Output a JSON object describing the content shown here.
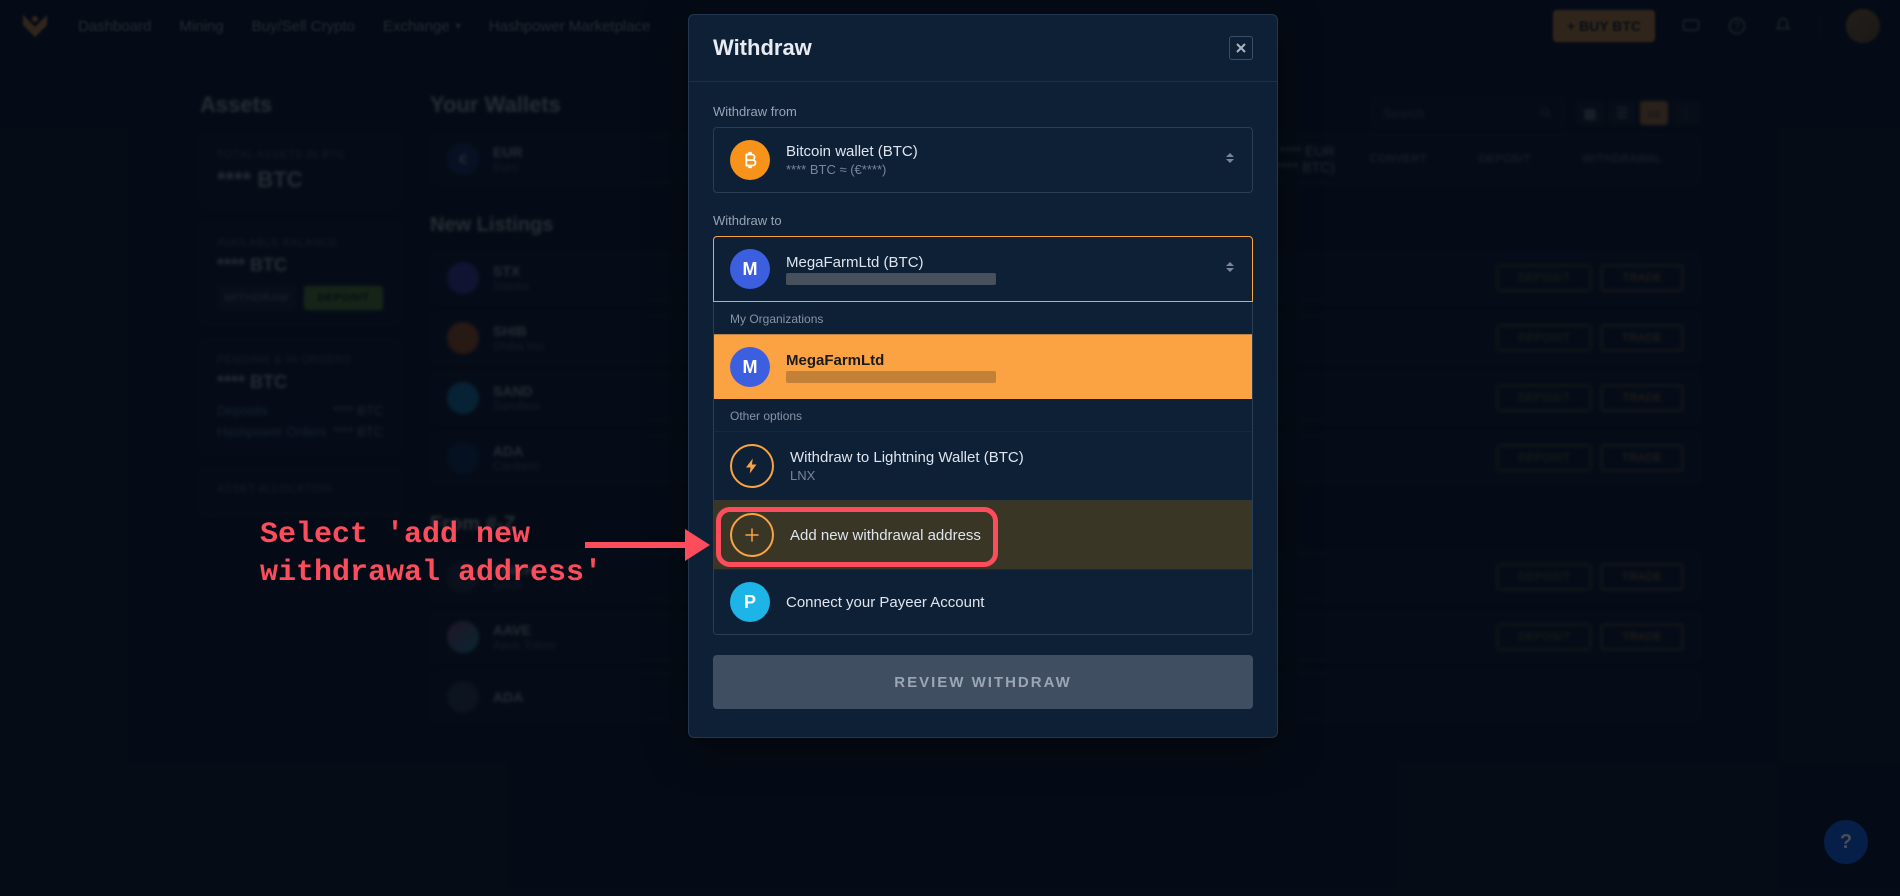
{
  "nav": {
    "items": [
      "Dashboard",
      "Mining",
      "Buy/Sell Crypto",
      "Exchange",
      "Hashpower Marketplace"
    ],
    "buy_label": "+ BUY BTC"
  },
  "assets": {
    "heading": "Assets",
    "total_label": "TOTAL ASSETS IN BTC",
    "total_value": "**** BTC",
    "avail_label": "AVAILABLE BALANCE",
    "avail_value": "**** BTC",
    "withdraw": "WITHDRAW",
    "deposit": "DEPOSIT",
    "pending_label": "PENDING & IN ORDERS",
    "pending_value": "**** BTC",
    "deposits_label": "Deposits",
    "deposits_value": "**** BTC",
    "hash_label": "Hashpower Orders",
    "hash_value": "**** BTC",
    "allocation_label": "ASSET ALLOCATION"
  },
  "wallets": {
    "heading": "Your Wallets",
    "new_listings": "New Listings",
    "from_az": "From #-Z",
    "search_placeholder": "Search",
    "row1": {
      "sym": "EUR",
      "sub": "Euro",
      "v1": "**** EUR",
      "v2": "(**** BTC)",
      "convert": "Convert",
      "deposit": "Deposit",
      "withdrawal": "Withdrawal"
    },
    "listing": [
      {
        "sym": "STX",
        "sub": "Stacks"
      },
      {
        "sym": "SHIB",
        "sub": "Shiba Inu"
      },
      {
        "sym": "SAND",
        "sub": "Sandbox"
      },
      {
        "sym": "ADA",
        "sub": "Cardano"
      }
    ],
    "az": [
      {
        "sym": "1INCH",
        "sub": "1inch"
      },
      {
        "sym": "AAVE",
        "sub": "Aave Token"
      },
      {
        "sym": "ADA",
        "sub": ""
      }
    ],
    "chip_deposit": "DEPOSIT",
    "chip_trade": "TRADE"
  },
  "modal": {
    "title": "Withdraw",
    "from_label": "Withdraw from",
    "from": {
      "title": "Bitcoin wallet (BTC)",
      "sub": "**** BTC ≈ (€****)"
    },
    "to_label": "Withdraw to",
    "selected": {
      "letter": "M",
      "title": "MegaFarmLtd (BTC)"
    },
    "section_orgs": "My Organizations",
    "org_option": {
      "letter": "M",
      "title": "MegaFarmLtd"
    },
    "section_other": "Other options",
    "lightning": {
      "title": "Withdraw to Lightning Wallet (BTC)",
      "sub": "LNX"
    },
    "add_new": "Add new withdrawal address",
    "payeer": {
      "letter": "P",
      "title": "Connect your Payeer Account"
    },
    "review": "REVIEW WITHDRAW"
  },
  "annotation": {
    "line1": "Select 'add new",
    "line2": "withdrawal address'"
  },
  "fab": "?"
}
